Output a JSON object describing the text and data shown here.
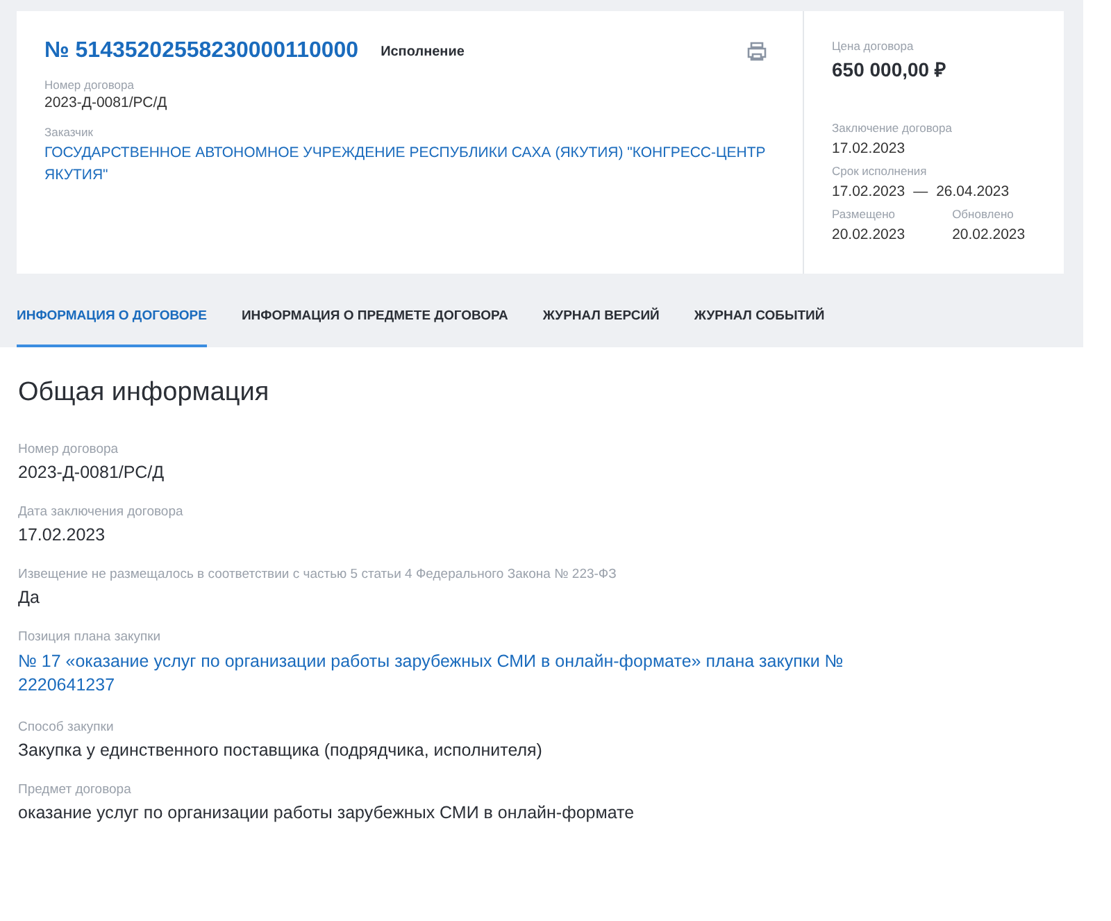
{
  "header": {
    "number": "№ 51435202558230000110000",
    "status": "Исполнение",
    "fields": [
      {
        "label": "Номер договора",
        "value": "2023-Д-0081/РС/Д",
        "kind": "text"
      },
      {
        "label": "Заказчик",
        "value": "ГОСУДАРСТВЕННОЕ АВТОНОМНОЕ УЧРЕЖДЕНИЕ РЕСПУБЛИКИ САХА (ЯКУТИЯ) \"КОНГРЕСС-ЦЕНТР ЯКУТИЯ\"",
        "kind": "link"
      }
    ]
  },
  "side": {
    "price_label": "Цена договора",
    "price": "650 000,00 ₽",
    "conclusion_label": "Заключение договора",
    "conclusion": "17.02.2023",
    "term_label": "Срок исполнения",
    "term_start": "17.02.2023",
    "term_sep": "—",
    "term_end": "26.04.2023",
    "placed_label": "Размещено",
    "placed": "20.02.2023",
    "updated_label": "Обновлено",
    "updated": "20.02.2023"
  },
  "tabs": [
    {
      "label": "ИНФОРМАЦИЯ О ДОГОВОРЕ",
      "selected": true
    },
    {
      "label": "ИНФОРМАЦИЯ О ПРЕДМЕТЕ ДОГОВОРА",
      "selected": false
    },
    {
      "label": "ЖУРНАЛ ВЕРСИЙ",
      "selected": false
    },
    {
      "label": "ЖУРНАЛ СОБЫТИЙ",
      "selected": false
    }
  ],
  "section": {
    "title": "Общая информация",
    "fields": [
      {
        "label": "Номер договора",
        "value": "2023-Д-0081/РС/Д",
        "kind": "text"
      },
      {
        "label": "Дата заключения договора",
        "value": "17.02.2023",
        "kind": "text"
      },
      {
        "label": "Извещение не размещалось в соответствии с частью 5 статьи 4 Федерального Закона № 223-ФЗ",
        "value": "Да",
        "kind": "text"
      },
      {
        "label": "Позиция плана закупки",
        "value": "№ 17 «оказание услуг по организации работы зарубежных СМИ в онлайн-формате» плана закупки № 2220641237",
        "kind": "link"
      },
      {
        "label": "Способ закупки",
        "value": "Закупка у единственного поставщика (подрядчика, исполнителя)",
        "kind": "text"
      },
      {
        "label": "Предмет договора",
        "value": "оказание услуг по организации работы зарубежных СМИ в онлайн-формате",
        "kind": "text"
      }
    ]
  }
}
